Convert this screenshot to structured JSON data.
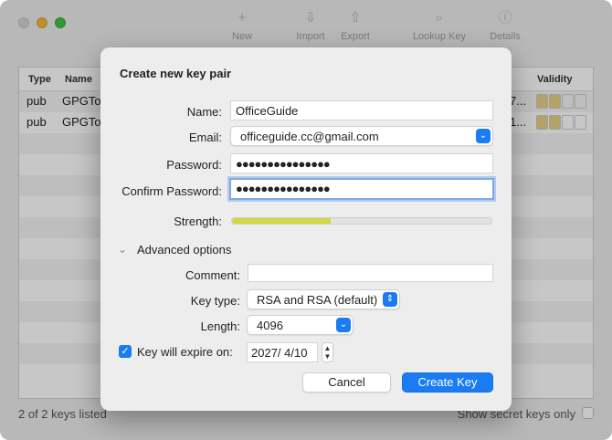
{
  "toolbar": {
    "new_label": "New",
    "import_label": "Import",
    "export_label": "Export",
    "lookup_label": "Lookup Key",
    "details_label": "Details"
  },
  "table": {
    "columns": [
      "Type",
      "Name",
      "Validity"
    ],
    "rows": [
      {
        "type": "pub",
        "name": "GPGTo",
        "tail": "7..."
      },
      {
        "type": "pub",
        "name": "GPGTo",
        "tail": "1..."
      }
    ]
  },
  "footer": {
    "count": "2 of 2 keys listed",
    "secret_only": "Show secret keys only"
  },
  "dialog": {
    "title": "Create new key pair",
    "name_label": "Name:",
    "name_value": "OfficeGuide",
    "email_label": "Email:",
    "email_value": "officeguide.cc@gmail.com",
    "password_label": "Password:",
    "password_value": "●●●●●●●●●●●●●●●",
    "confirm_label": "Confirm Password:",
    "confirm_value": "●●●●●●●●●●●●●●●",
    "strength_label": "Strength:",
    "strength_fraction": 0.38,
    "advanced_label": "Advanced options",
    "comment_label": "Comment:",
    "comment_value": "",
    "keytype_label": "Key type:",
    "keytype_value": "RSA and RSA (default)",
    "length_label": "Length:",
    "length_value": "4096",
    "expire_label": "Key will expire on:",
    "expire_checked": true,
    "expire_value": "2027/  4/10",
    "cancel_label": "Cancel",
    "create_label": "Create Key"
  },
  "colors": {
    "accent": "#1a7cf2",
    "strength": "#d2d742",
    "validity": "#e8d083"
  }
}
